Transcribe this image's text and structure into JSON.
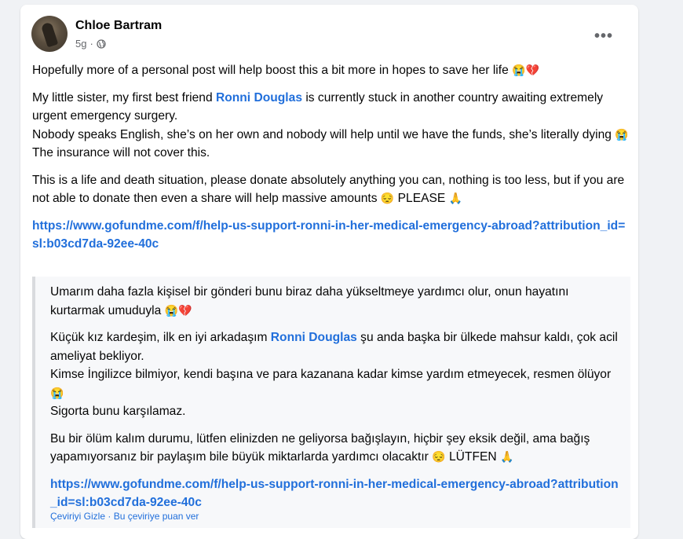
{
  "post": {
    "author": "Chloe Bartram",
    "time": "5g",
    "more_icon": "more-horizontal-icon",
    "privacy_icon": "globe-icon",
    "paragraphs": {
      "p1": "Hopefully more of a personal post will help boost this a bit more in hopes to save her life",
      "p1_emoji": "😭💔",
      "p2_before": "My little sister, my first best friend ",
      "p2_mention": "Ronni Douglas",
      "p2_after": " is currently stuck in another country awaiting extremely urgent emergency surgery.",
      "p2_line2": "Nobody speaks English, she’s on her own and nobody will help until we have the funds, she’s literally dying",
      "p2_line2_emoji": "😭",
      "p2_line3": "The insurance will not cover this.",
      "p3": "This is a life and death situation, please donate absolutely anything you can, nothing is too less, but if you are not able to donate then even a share will help massive amounts",
      "p3_emoji1": "😔",
      "p3_please": "PLEASE",
      "p3_emoji2": "🙏",
      "link": "https://www.gofundme.com/f/help-us-support-ronni-in-her-medical-emergency-abroad?attribution_id=sl:b03cd7da-92ee-40c"
    }
  },
  "translation": {
    "q1": "Umarım daha fazla kişisel bir gönderi bunu biraz daha yükseltmeye yardımcı olur, onun hayatını kurtarmak umuduyla",
    "q1_emoji": "😭💔",
    "q2_before": "Küçük kız kardeşim, ilk en iyi arkadaşım ",
    "q2_mention": "Ronni Douglas",
    "q2_after": " şu anda başka bir ülkede mahsur kaldı, çok acil ameliyat bekliyor.",
    "q2_line2": "Kimse İngilizce bilmiyor, kendi başına ve para kazanana kadar kimse yardım etmeyecek, resmen ölüyor",
    "q2_line2_emoji": "😭",
    "q2_line3": "Sigorta bunu karşılamaz.",
    "q3": "Bu bir ölüm kalım durumu, lütfen elinizden ne geliyorsa bağışlayın, hiçbir şey eksik değil, ama bağış yapamıyorsanız bir paylaşım bile büyük miktarlarda yardımcı olacaktır",
    "q3_emoji1": "😔",
    "q3_please": "LÜTFEN",
    "q3_emoji2": "🙏",
    "link": "https://www.gofundme.com/f/help-us-support-ronni-in-her-medical-emergency-abroad?attribution_id=sl:b03cd7da-92ee-40c"
  },
  "footer": {
    "hide_translation": "Çeviriyi Gizle",
    "rate_translation": "Bu çeviriye puan ver"
  }
}
